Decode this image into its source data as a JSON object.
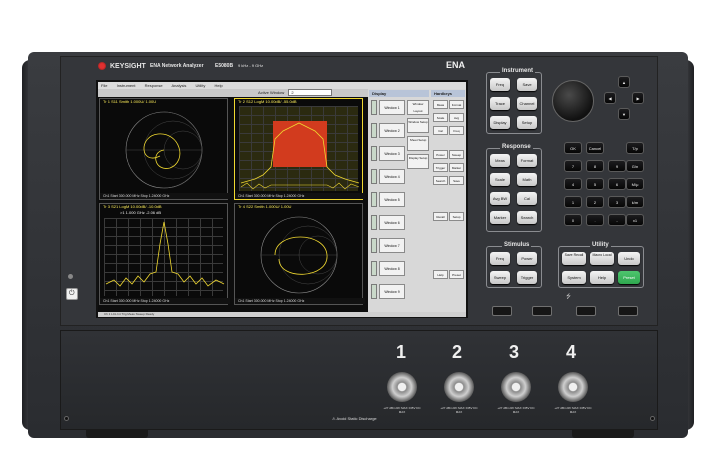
{
  "header": {
    "brand": "KEYSIGHT",
    "product": "ENA Network Analyzer",
    "model": "E5080B",
    "range": "9 kHz - 9 GHz",
    "series": "ENA"
  },
  "screen": {
    "menus": [
      "File",
      "Instrument",
      "Response",
      "Analysis",
      "Utility",
      "Help"
    ],
    "active_window_label": "Active Window",
    "active_window_value": "2",
    "windows": [
      {
        "title": "Tr 1  S11 Smith 1.000U/  1.00U",
        "footer": "Ch1  Start  300.000 MHz   Stop  1.24000 GHz"
      },
      {
        "title": "Tr 2  S12 LogM 10.00dB/  -55.0dB",
        "footer": "Ch1  Start  300.000 MHz   Stop  1.24000 GHz"
      },
      {
        "title": "Tr 3  S21 LogM 10.00dB/  -10.0dB",
        "marker": ">1    1.000 GHz    -2.06 dB",
        "footer": "Ch1  Start  300.000 MHz   Stop  1.24000 GHz"
      },
      {
        "title": "Tr 4  S22 Smith 1.000U/  1.00U",
        "footer": "Ch1  Start  300.000 MHz   Stop  1.24000 GHz"
      }
    ],
    "display_panel": {
      "head": "Display",
      "items": [
        "Window 1",
        "Window 2",
        "Window 3",
        "Window 4",
        "Window 5",
        "Window 6",
        "Window 7",
        "Window 8",
        "Window 9"
      ],
      "side": [
        "Window Layout",
        "Window Setup",
        "Sheet Setup",
        "Display Setup"
      ]
    },
    "hardkey_panel": {
      "head": "Hardkeys",
      "items": [
        "Meas",
        "Format",
        "Scale",
        "Avg",
        "Cal",
        "Freq",
        "Power",
        "Sweep",
        "Trigger",
        "Marker",
        "Search",
        "Save",
        "Recall",
        "Setup",
        "Help",
        "Preset"
      ]
    },
    "status": "Ch 1   LCL   Int Trig   Meas   Sweep   Ready"
  },
  "panels": {
    "instrument": {
      "label": "Instrument",
      "keys": [
        "Freq",
        "Save",
        "Trace",
        "Channel",
        "Display",
        "Setup"
      ]
    },
    "response": {
      "label": "Response",
      "keys": [
        "Meas",
        "Format",
        "Scale",
        "Math",
        "Avg BW",
        "Cal",
        "Marker",
        "Search"
      ]
    },
    "stimulus": {
      "label": "Stimulus",
      "keys": [
        "Freq",
        "Power",
        "Sweep",
        "Trigger"
      ]
    },
    "utility": {
      "label": "Utility",
      "keys": [
        "Save Recall",
        "Macro Local",
        "Undo",
        "System",
        "Help",
        "Preset"
      ]
    },
    "entry": {
      "keys": [
        "OK",
        "Cancel",
        "T/p",
        "7",
        "8",
        "9",
        "G/n",
        "4",
        "5",
        "6",
        "M/μ",
        "1",
        "2",
        "3",
        "k/m",
        "0",
        ".",
        "-",
        "x1"
      ]
    }
  },
  "ports": {
    "numbers": [
      "1",
      "2",
      "3",
      "4"
    ],
    "warning": "+27 dBm RF MAX  ±35V DC MAX",
    "static": "⚠ Avoid Static Discharge"
  },
  "colors": {
    "trace": "#f0d830",
    "mask": "#d23b1e",
    "preset": "#2fa84f",
    "body": "#34363a"
  }
}
